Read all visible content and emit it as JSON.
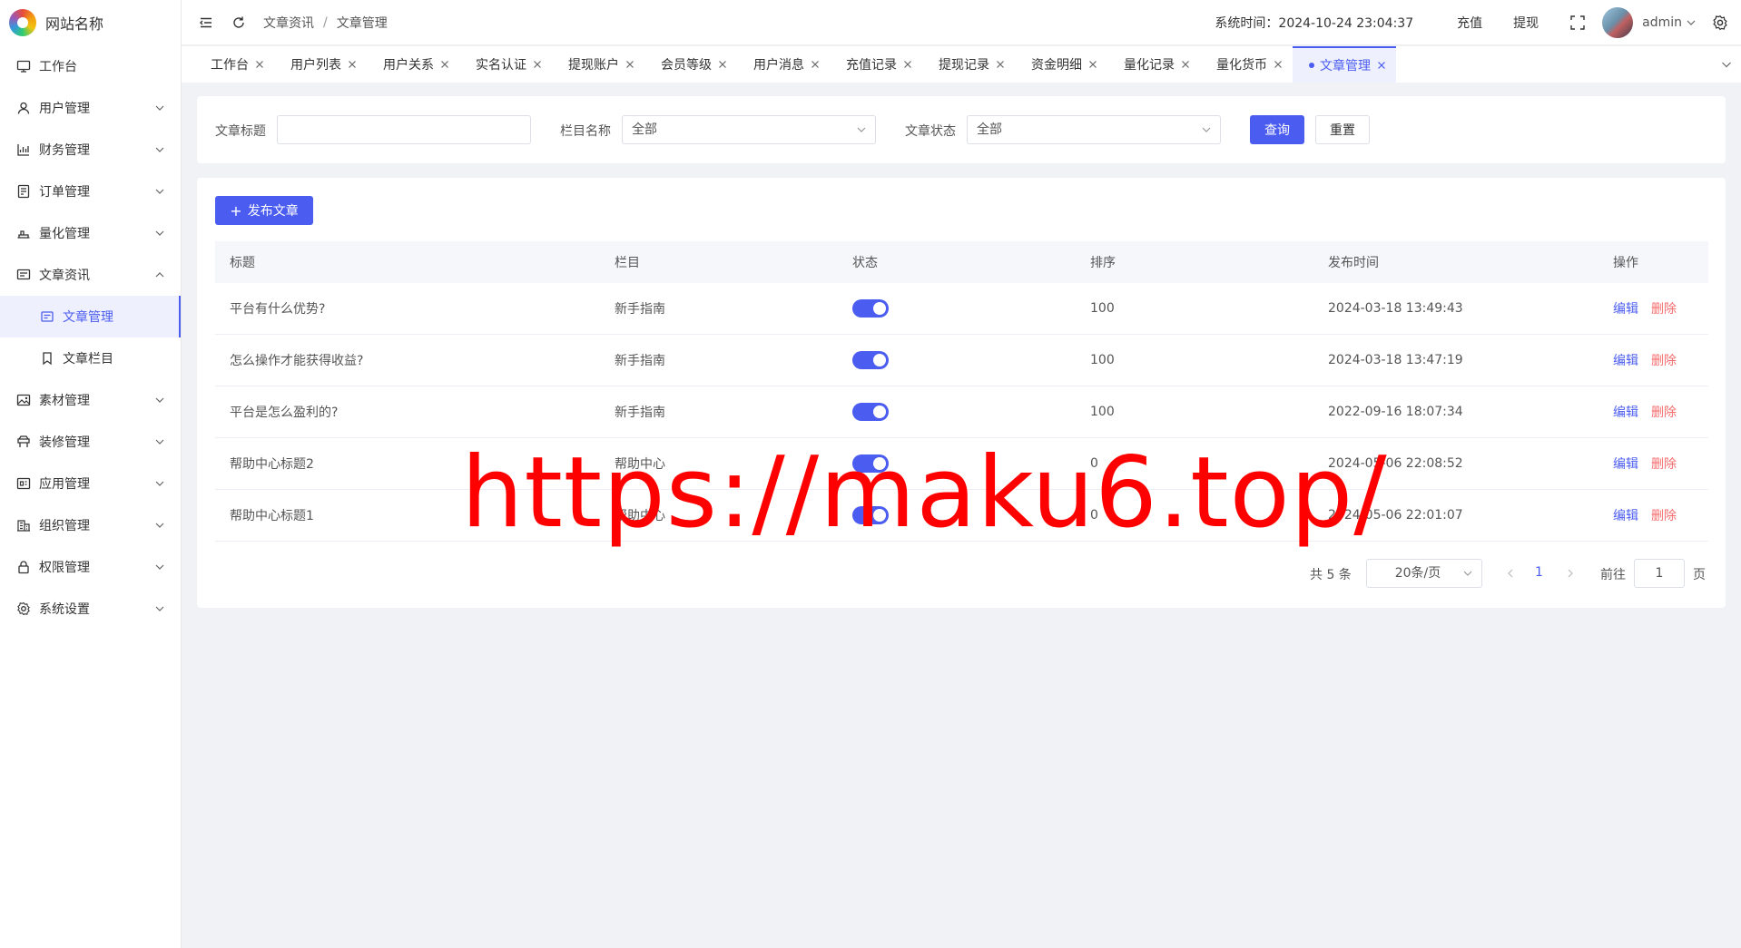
{
  "app": {
    "site_name": "网站名称"
  },
  "sidebar": {
    "items": [
      {
        "label": "工作台",
        "icon": "monitor-icon"
      },
      {
        "label": "用户管理",
        "icon": "user-icon"
      },
      {
        "label": "财务管理",
        "icon": "chart-icon"
      },
      {
        "label": "订单管理",
        "icon": "order-icon"
      },
      {
        "label": "量化管理",
        "icon": "quant-icon"
      },
      {
        "label": "文章资讯",
        "icon": "article-icon"
      },
      {
        "label": "文章管理",
        "icon": "doc-icon"
      },
      {
        "label": "文章栏目",
        "icon": "bookmark-icon"
      },
      {
        "label": "素材管理",
        "icon": "image-icon"
      },
      {
        "label": "装修管理",
        "icon": "decor-icon"
      },
      {
        "label": "应用管理",
        "icon": "app-icon"
      },
      {
        "label": "组织管理",
        "icon": "org-icon"
      },
      {
        "label": "权限管理",
        "icon": "lock-icon"
      },
      {
        "label": "系统设置",
        "icon": "gear-icon"
      }
    ]
  },
  "header": {
    "breadcrumb": [
      "文章资讯",
      "文章管理"
    ],
    "breadcrumb_sep": "/",
    "system_time": "系统时间：2024-10-24 23:04:37",
    "recharge": "充值",
    "withdraw": "提现",
    "username": "admin"
  },
  "tabs": [
    {
      "label": "工作台"
    },
    {
      "label": "用户列表"
    },
    {
      "label": "用户关系"
    },
    {
      "label": "实名认证"
    },
    {
      "label": "提现账户"
    },
    {
      "label": "会员等级"
    },
    {
      "label": "用户消息"
    },
    {
      "label": "充值记录"
    },
    {
      "label": "提现记录"
    },
    {
      "label": "资金明细"
    },
    {
      "label": "量化记录"
    },
    {
      "label": "量化货币"
    },
    {
      "label": "文章管理",
      "active": true
    }
  ],
  "search": {
    "title_label": "文章标题",
    "title_value": "",
    "column_label": "栏目名称",
    "column_value": "全部",
    "status_label": "文章状态",
    "status_value": "全部",
    "query_button": "查询",
    "reset_button": "重置"
  },
  "table": {
    "publish_button": "发布文章",
    "publish_icon": "+",
    "columns": [
      "标题",
      "栏目",
      "状态",
      "排序",
      "发布时间",
      "操作"
    ],
    "rows": [
      {
        "title": "平台有什么优势?",
        "column": "新手指南",
        "status": true,
        "sort": "100",
        "time": "2024-03-18 13:49:43"
      },
      {
        "title": "怎么操作才能获得收益?",
        "column": "新手指南",
        "status": true,
        "sort": "100",
        "time": "2024-03-18 13:47:19"
      },
      {
        "title": "平台是怎么盈利的?",
        "column": "新手指南",
        "status": true,
        "sort": "100",
        "time": "2022-09-16 18:07:34"
      },
      {
        "title": "帮助中心标题2",
        "column": "帮助中心",
        "status": true,
        "sort": "0",
        "time": "2024-05-06 22:08:52"
      },
      {
        "title": "帮助中心标题1",
        "column": "帮助中心",
        "status": true,
        "sort": "0",
        "time": "2024-05-06 22:01:07"
      }
    ],
    "edit_label": "编辑",
    "delete_label": "删除"
  },
  "pagination": {
    "total": "共 5 条",
    "page_size": "20条/页",
    "current_page": "1",
    "goto_prefix": "前往",
    "goto_value": "1",
    "goto_suffix": "页"
  },
  "watermark": "https://maku6.top/",
  "colors": {
    "primary": "#4b5cf0",
    "danger": "#f56c6c",
    "watermark": "#ff0000"
  }
}
